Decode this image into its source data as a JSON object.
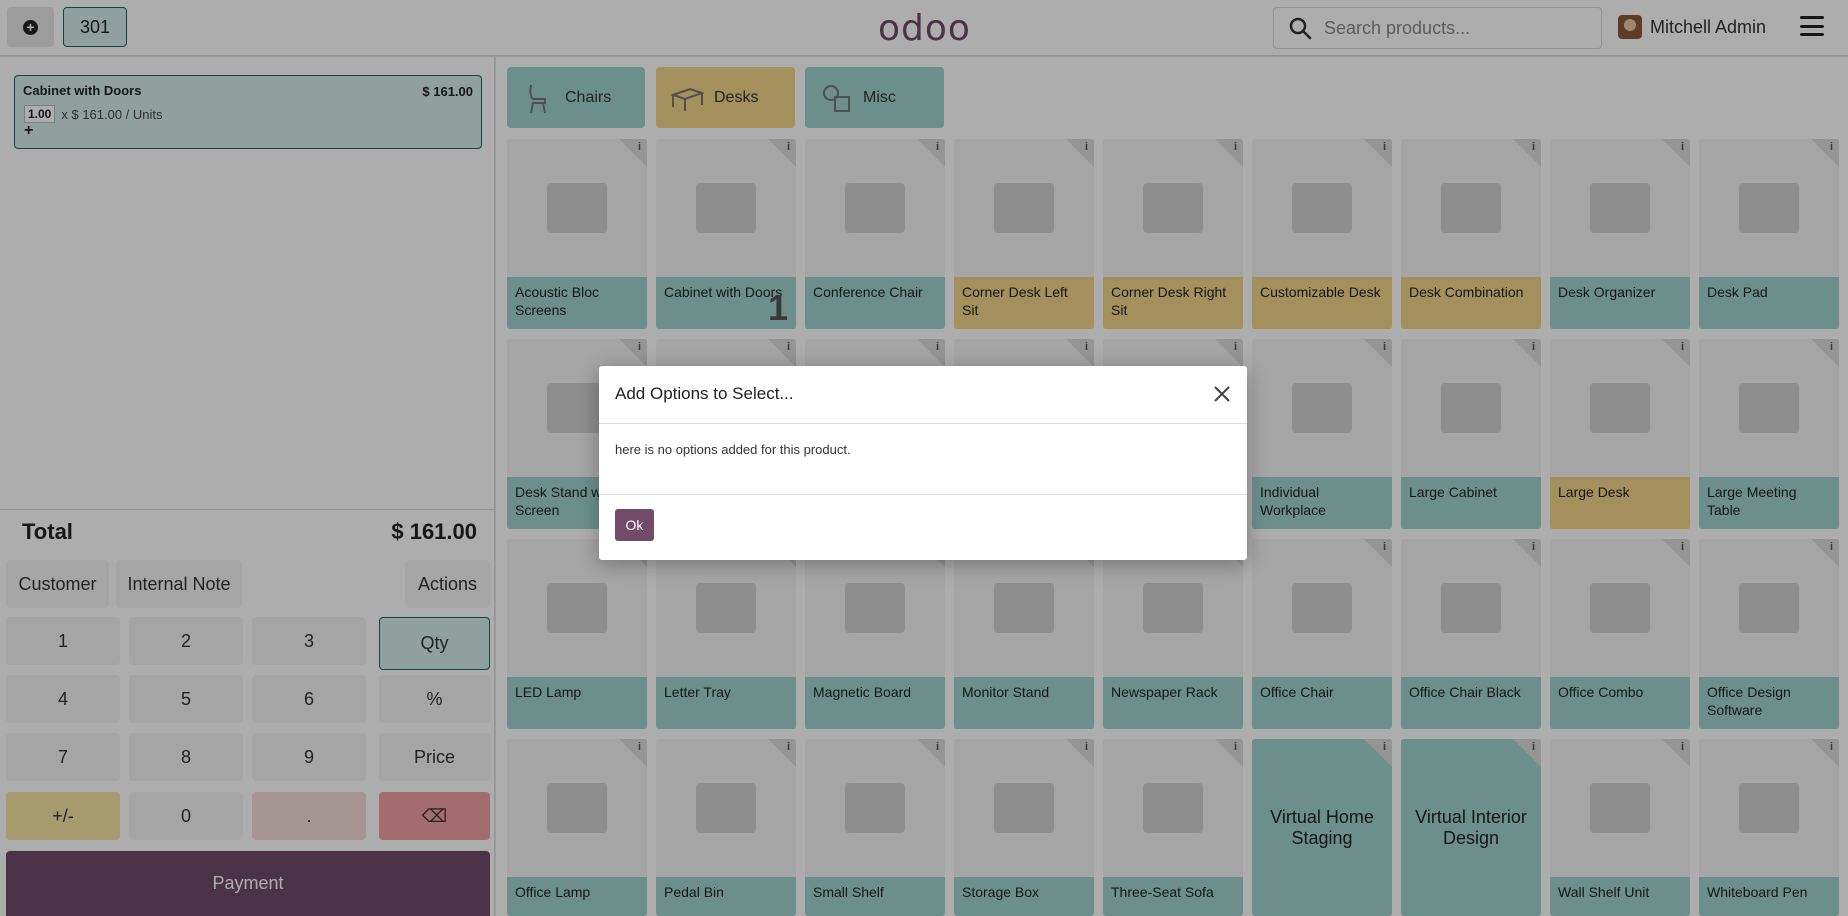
{
  "topbar": {
    "order_number": "301",
    "logo": "odoo",
    "search_placeholder": "Search products...",
    "user_name": "Mitchell Admin"
  },
  "order": {
    "line": {
      "name": "Cabinet with Doors",
      "price": "$ 161.00",
      "qty": "1.00",
      "unit_price": "x $ 161.00 / Units",
      "add": "+"
    },
    "total_label": "Total",
    "total_value": "$ 161.00"
  },
  "controls": {
    "customer": "Customer",
    "internal_note": "Internal Note",
    "actions": "Actions"
  },
  "numpad": {
    "k1": "1",
    "k2": "2",
    "k3": "3",
    "qty": "Qty",
    "k4": "4",
    "k5": "5",
    "k6": "6",
    "pct": "%",
    "k7": "7",
    "k8": "8",
    "k9": "9",
    "price": "Price",
    "plusminus": "+/-",
    "k0": "0",
    "dot": ".",
    "backspace": "⌫"
  },
  "payment_label": "Payment",
  "categories": [
    {
      "label": "Chairs",
      "color": "#9fd3cd"
    },
    {
      "label": "Desks",
      "color": "#f1d58a"
    },
    {
      "label": "Misc",
      "color": "#9fd3cd"
    }
  ],
  "products": {
    "row1": [
      "Acoustic Bloc Screens",
      "Cabinet with Doors",
      "Conference Chair",
      "Corner Desk Left Sit",
      "Corner Desk Right Sit",
      "Customizable Desk",
      "Desk Combination",
      "Desk Organizer",
      "Desk Pad"
    ],
    "row2": [
      "Desk Stand with Screen",
      "",
      "",
      "",
      "",
      "Individual Workplace",
      "Large Cabinet",
      "Large Desk",
      "Large Meeting Table"
    ],
    "row3": [
      "LED Lamp",
      "Letter Tray",
      "Magnetic Board",
      "Monitor Stand",
      "Newspaper Rack",
      "Office Chair",
      "Office Chair Black",
      "Office Combo",
      "Office Design Software"
    ],
    "row4": [
      "Office Lamp",
      "Pedal Bin",
      "Small Shelf",
      "Storage Box",
      "Three-Seat Sofa",
      "Virtual Home Staging",
      "Virtual Interior Design",
      "Wall Shelf Unit",
      "Whiteboard Pen"
    ],
    "cart_qty_badge": "1",
    "info_glyph": "i"
  },
  "modal": {
    "title": "Add Options to Select...",
    "body": "here is no options added for this product.",
    "ok": "Ok"
  },
  "colors": {
    "brand": "#714b67",
    "accent_teal": "#1a6b63",
    "tile_teal": "#9fd3cd",
    "tile_yellow": "#f1d58a"
  }
}
